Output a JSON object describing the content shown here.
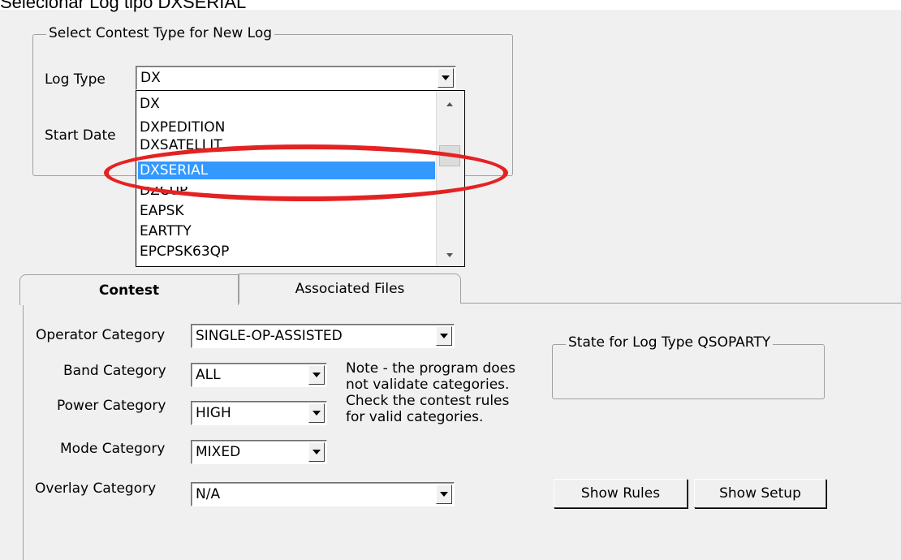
{
  "caption": "Selecionar Log tipo DXSERIAL",
  "new_log": {
    "group_title": "Select Contest Type for New Log",
    "log_type_label": "Log Type",
    "log_type_value": "DX",
    "start_date_label": "Start Date"
  },
  "dropdown": {
    "items": [
      "DX",
      "DXPEDITION",
      "DXSATELLIT",
      "DXSERIAL",
      "DZCUP",
      "EAPSK",
      "EARTTY",
      "EPCPSK63QP"
    ],
    "selected": "DXSERIAL"
  },
  "highlight_color": "#e52222",
  "tabs": [
    {
      "label": "Contest",
      "active": true
    },
    {
      "label": "Associated Files",
      "active": false
    }
  ],
  "contest": {
    "operator_category_label": "Operator Category",
    "operator_category_value": "SINGLE-OP-ASSISTED",
    "band_category_label": "Band Category",
    "band_category_value": "ALL",
    "power_category_label": "Power Category",
    "power_category_value": "HIGH",
    "mode_category_label": "Mode Category",
    "mode_category_value": "MIXED",
    "overlay_category_label": "Overlay Category",
    "overlay_category_value": "N/A",
    "note": "Note -  the program does not validate categories. Check the contest rules for valid categories.",
    "state_group_title": "State for Log Type QSOPARTY",
    "show_rules_label": "Show Rules",
    "show_setup_label": "Show Setup"
  }
}
